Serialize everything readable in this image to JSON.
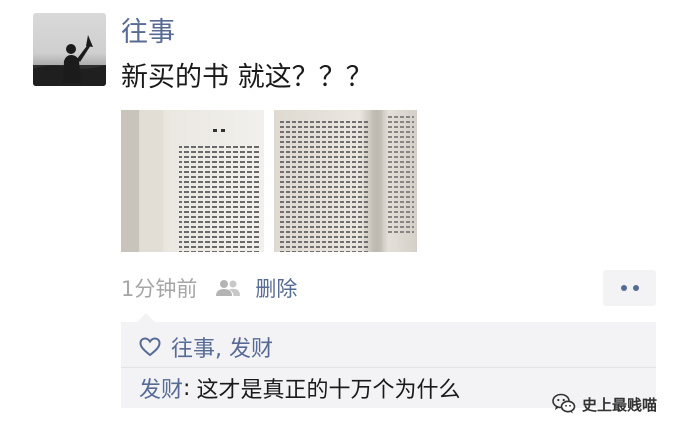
{
  "post": {
    "author": "往事",
    "text": "新买的书 就这？？？",
    "images": [
      {
        "name": "book-page-photo-1",
        "icon": "photo"
      },
      {
        "name": "book-page-photo-2",
        "icon": "photo"
      }
    ],
    "timestamp": "1分钟前",
    "visibility_icon": "friends-icon",
    "delete_label": "删除",
    "more_icon": "more-dots-icon"
  },
  "likes": {
    "icon": "heart-icon",
    "names": "往事, 发财"
  },
  "comments": [
    {
      "author": "发财",
      "separator": ":",
      "text": "这才是真正的十万个为什么"
    }
  ],
  "watermark": {
    "icon": "wechat-icon",
    "text": "史上最贱喵"
  },
  "colors": {
    "link": "#576b95",
    "text": "#1a1a1a",
    "muted": "#a6a6a6",
    "comment_bg": "#f3f3f5"
  }
}
